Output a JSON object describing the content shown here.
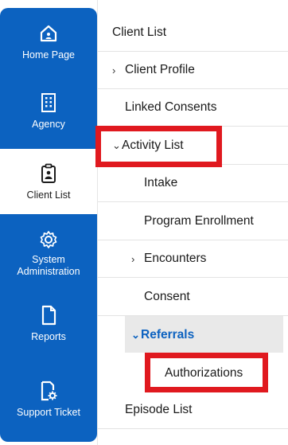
{
  "sidebar": {
    "items": [
      {
        "label": "Home Page",
        "icon": "home-icon",
        "active": false
      },
      {
        "label": "Agency",
        "icon": "building-icon",
        "active": false
      },
      {
        "label": "Client List",
        "icon": "clipboard-user-icon",
        "active": true
      },
      {
        "label": "System Administration",
        "icon": "gear-icon",
        "active": false
      },
      {
        "label": "Reports",
        "icon": "document-icon",
        "active": false
      },
      {
        "label": "Support Ticket",
        "icon": "ticket-gear-icon",
        "active": false
      }
    ],
    "colors": {
      "background": "#0c62c0",
      "active_background": "#ffffff"
    }
  },
  "menu": {
    "client_list": "Client List",
    "client_profile": "Client Profile",
    "linked_consents": "Linked Consents",
    "activity_list": "Activity List",
    "intake": "Intake",
    "program_enrollment": "Program Enrollment",
    "encounters": "Encounters",
    "consent": "Consent",
    "referrals": "Referrals",
    "authorizations": "Authorizations",
    "episode_list": "Episode List",
    "colors": {
      "highlight_box": "#e0191f",
      "selected_text": "#0c62c0",
      "selected_background": "#e9e9e9"
    }
  }
}
